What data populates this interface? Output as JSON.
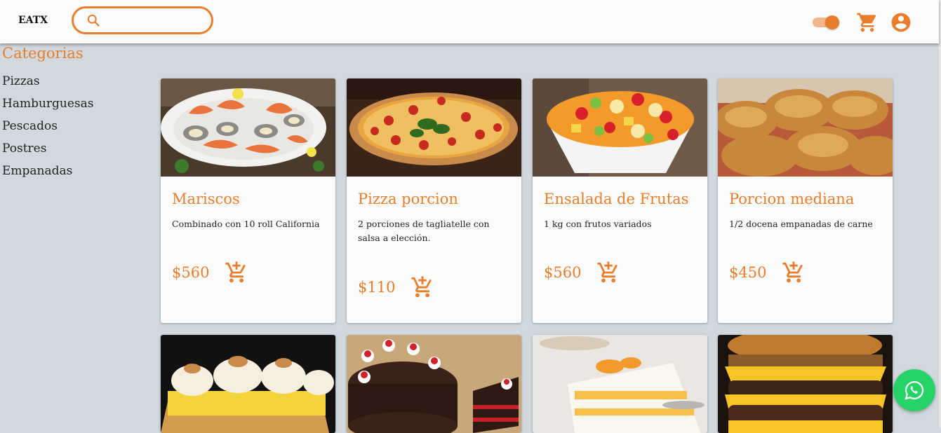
{
  "header": {
    "brand": "EATX",
    "search_placeholder": "",
    "toggle_state": "on"
  },
  "sidebar": {
    "title": "Categorias",
    "items": [
      {
        "label": "Pizzas"
      },
      {
        "label": "Hamburguesas"
      },
      {
        "label": "Pescados"
      },
      {
        "label": "Postres"
      },
      {
        "label": "Empanadas"
      }
    ]
  },
  "products": [
    {
      "title": "Mariscos",
      "description": "Combinado con 10 roll California",
      "price": "$560",
      "image": "seafood platter"
    },
    {
      "title": "Pizza porcion",
      "description": "2 porciones de tagliatelle con salsa a elección.",
      "price": "$110",
      "image": "pizza"
    },
    {
      "title": "Ensalada de Frutas",
      "description": "1 kg con frutos variados",
      "price": "$560",
      "image": "fruit salad"
    },
    {
      "title": "Porcion mediana",
      "description": "1/2 docena empanadas de carne",
      "price": "$450",
      "image": "empanadas"
    },
    {
      "title": "",
      "description": "",
      "price": "",
      "image": "lemon meringue pie"
    },
    {
      "title": "",
      "description": "",
      "price": "",
      "image": "chocolate cake"
    },
    {
      "title": "",
      "description": "",
      "price": "",
      "image": "peach cream cake"
    },
    {
      "title": "",
      "description": "",
      "price": "",
      "image": "cheeseburger"
    }
  ],
  "colors": {
    "accent": "#e87d2c",
    "background": "#d1d9de",
    "card": "#fbfbfb",
    "whatsapp": "#25d366"
  },
  "icons": [
    "search-icon",
    "cart-icon",
    "account-icon",
    "add-to-cart-icon",
    "whatsapp-icon"
  ]
}
